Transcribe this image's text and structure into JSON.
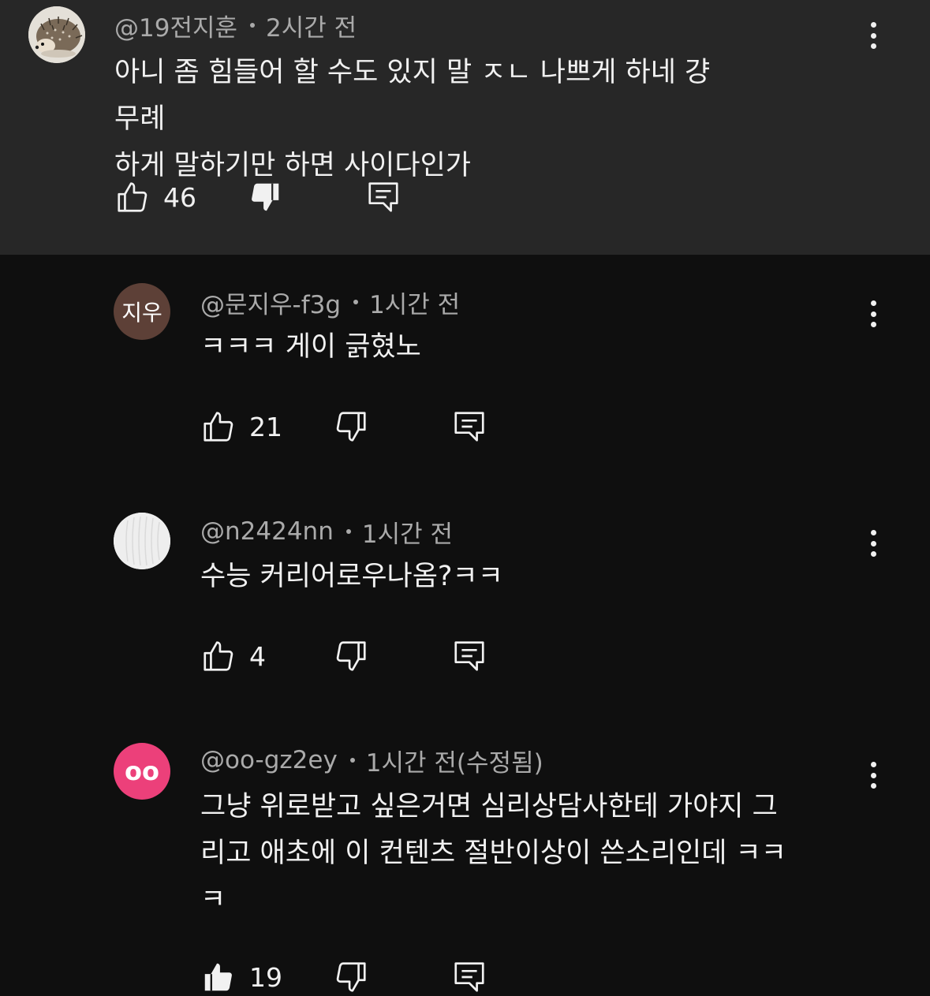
{
  "comments": [
    {
      "author": "@19전지훈",
      "time": "2시간 전",
      "text_line1": "아니 좀 힘들어 할 수도 있지 말 ㅈㄴ 나쁘게 하네 걍 무례",
      "text_line2": "하게 말하기만 하면 사이다인가",
      "likes": "46",
      "avatar_type": "hedgehog-image",
      "liked": false,
      "disliked": true
    },
    {
      "author": "@문지우-f3g",
      "time": "1시간 전",
      "text_line1": "ㅋㅋㅋ 게이 긁혔노",
      "likes": "21",
      "avatar_text": "지우",
      "avatar_color": "#5d4037",
      "liked": false,
      "disliked": false
    },
    {
      "author": "@n2424nn",
      "time": "1시간 전",
      "text_line1": "수능 커리어로우나옴?ㅋㅋ",
      "likes": "4",
      "avatar_type": "white-image",
      "liked": false,
      "disliked": false
    },
    {
      "author": "@oo-gz2ey",
      "time": "1시간 전(수정됨)",
      "text_line1": "그냥 위로받고 싶은거면 심리상담사한테 가야지 그",
      "text_line2": "리고 애초에 이 컨텐츠 절반이상이 쓴소리인데 ㅋㅋ",
      "text_line3": "ㅋ",
      "likes": "19",
      "avatar_text": "oo",
      "avatar_color": "#ec407a",
      "liked": true,
      "disliked": false
    }
  ],
  "icons": {
    "like": "thumbs-up-icon",
    "dislike": "thumbs-down-icon",
    "reply": "reply-icon",
    "more": "more-vert-icon"
  }
}
